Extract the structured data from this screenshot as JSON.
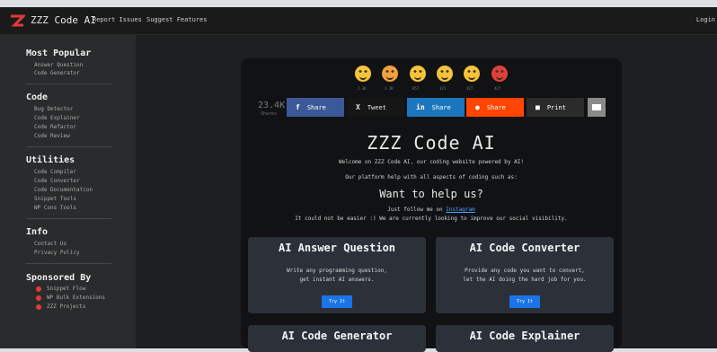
{
  "topbar": {
    "brand": "ZZZ Code AI",
    "nav": [
      "Report Issues",
      "Suggest Features"
    ],
    "login": "Login"
  },
  "sidebar": {
    "most_popular": {
      "title": "Most Popular",
      "items": [
        "Answer Question",
        "Code Generator"
      ]
    },
    "code": {
      "title": "Code",
      "items": [
        "Bug Detector",
        "Code Explainer",
        "Code Refactor",
        "Code Review"
      ]
    },
    "utilities": {
      "title": "Utilities",
      "items": [
        "Code Compiler",
        "Code Converter",
        "Code Documentation",
        "Snippet Tools",
        "WP Cons Tools"
      ]
    },
    "info": {
      "title": "Info",
      "items": [
        "Contact Us",
        "Privacy Policy"
      ]
    },
    "sponsored": {
      "title": "Sponsored By",
      "items": [
        "Snippet Flow",
        "WP Bulk Extensions",
        "ZZZ Projects"
      ]
    }
  },
  "reactions": {
    "counts": [
      "2.3K",
      "3.1K",
      "857",
      "321",
      "427",
      "427"
    ]
  },
  "counter": {
    "value": "23.4K",
    "label": "Shares"
  },
  "share": {
    "facebook": "Share",
    "twitter": "Tweet",
    "linkedin": "Share",
    "reddit": "Share",
    "print": "Print"
  },
  "hero": {
    "title": "ZZZ Code AI",
    "welcome": "Welcome on ZZZ Code AI, our coding website powered by AI!",
    "platform": "Our platform help with all aspects of coding such as:",
    "help_title": "Want to help us?",
    "follow_prefix": "Just follow me on ",
    "follow_link": "Instagram",
    "easier": "It could not be easier :) We are currently looking to improve our social visibility."
  },
  "features": [
    {
      "title": "AI Answer Question",
      "desc1": "Write any programming question,",
      "desc2": "get instant AI answers.",
      "button": "Try It"
    },
    {
      "title": "AI Code Converter",
      "desc1": "Provide any code you want to convert,",
      "desc2": "let the AI doing the hard job for you.",
      "button": "Try It"
    },
    {
      "title": "AI Code Generator"
    },
    {
      "title": "AI Code Explainer"
    }
  ]
}
